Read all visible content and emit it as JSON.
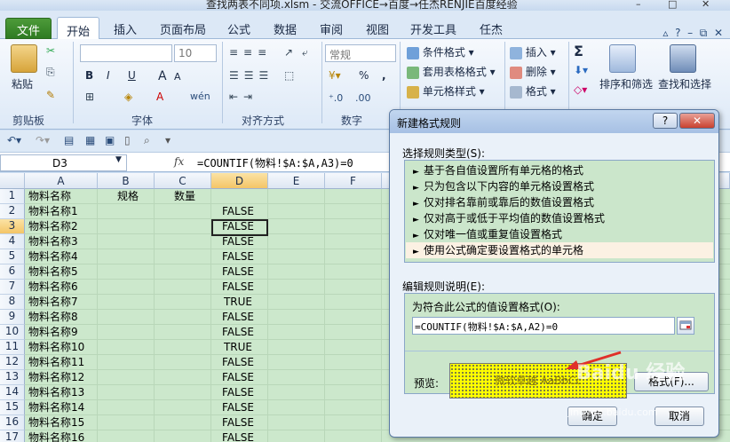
{
  "window": {
    "title": "查找两表不同项.xlsm - 交流OFFICE→百度→任杰RENJIE百度经验",
    "controls": [
      "–",
      "□",
      "✕"
    ]
  },
  "ribbon": {
    "tabs": [
      "文件",
      "开始",
      "插入",
      "页面布局",
      "公式",
      "数据",
      "审阅",
      "视图",
      "开发工具",
      "任杰"
    ],
    "active_tab": "开始",
    "clipboard": {
      "paste": "粘贴",
      "group": "剪贴板"
    },
    "font": {
      "font_size": "10",
      "bold": "B",
      "italic": "I",
      "underline": "U",
      "grow": "A",
      "shrink": "A",
      "wen": "wén",
      "group": "字体"
    },
    "align": {
      "group": "对齐方式"
    },
    "number": {
      "format": "常规",
      "percent": "%",
      "comma": ",",
      "group": "数字"
    },
    "styles": {
      "conditional": "条件格式",
      "table": "套用表格格式",
      "cell": "单元格样式"
    },
    "cells": {
      "insert": "插入",
      "delete": "删除",
      "format": "格式"
    },
    "editing": {
      "sigma": "Σ",
      "sort": "排序和筛选",
      "find": "查找和选择"
    }
  },
  "formula_bar": {
    "name_box": "D3",
    "fx": "fx",
    "formula": "=COUNTIF(物料!$A:$A,A3)=0"
  },
  "sheet": {
    "columns": [
      "A",
      "B",
      "C",
      "D",
      "E",
      "F"
    ],
    "selected_column": "D",
    "selected_row": "3",
    "header_row": {
      "a": "物料名称",
      "b": "规格",
      "c": "数量"
    },
    "rows": [
      {
        "n": "1",
        "a": "物料名称",
        "b": "规格",
        "c": "数量",
        "d": ""
      },
      {
        "n": "2",
        "a": "物料名称1",
        "d": "FALSE"
      },
      {
        "n": "3",
        "a": "物料名称2",
        "d": "FALSE"
      },
      {
        "n": "4",
        "a": "物料名称3",
        "d": "FALSE"
      },
      {
        "n": "5",
        "a": "物料名称4",
        "d": "FALSE"
      },
      {
        "n": "6",
        "a": "物料名称5",
        "d": "FALSE"
      },
      {
        "n": "7",
        "a": "物料名称6",
        "d": "FALSE"
      },
      {
        "n": "8",
        "a": "物料名称7",
        "d": "TRUE"
      },
      {
        "n": "9",
        "a": "物料名称8",
        "d": "FALSE"
      },
      {
        "n": "10",
        "a": "物料名称9",
        "d": "FALSE"
      },
      {
        "n": "11",
        "a": "物料名称10",
        "d": "TRUE"
      },
      {
        "n": "12",
        "a": "物料名称11",
        "d": "FALSE"
      },
      {
        "n": "13",
        "a": "物料名称12",
        "d": "FALSE"
      },
      {
        "n": "14",
        "a": "物料名称13",
        "d": "FALSE"
      },
      {
        "n": "15",
        "a": "物料名称14",
        "d": "FALSE"
      },
      {
        "n": "16",
        "a": "物料名称15",
        "d": "FALSE"
      },
      {
        "n": "17",
        "a": "物料名称16",
        "d": "FALSE"
      }
    ]
  },
  "dialog": {
    "title": "新建格式规则",
    "help": "?",
    "close": "✕",
    "select_type_label": "选择规则类型(S):",
    "rules": [
      "基于各自值设置所有单元格的格式",
      "只为包含以下内容的单元格设置格式",
      "仅对排名靠前或靠后的数值设置格式",
      "仅对高于或低于平均值的数值设置格式",
      "仅对唯一值或重复值设置格式",
      "使用公式确定要设置格式的单元格"
    ],
    "selected_rule_index": 5,
    "edit_desc_label": "编辑规则说明(E):",
    "formula_label": "为符合此公式的值设置格式(O):",
    "formula_value": "=COUNTIF(物料!$A:$A,A2)=0",
    "preview_label": "预览:",
    "preview_text": "微软卓越 AaBbCc",
    "format_button": "格式(F)...",
    "ok_button": "确定",
    "cancel_button": "取消",
    "preview_fill": "#ffff00"
  },
  "watermark": {
    "logo": "Baidu 经验",
    "url": "jingyan.baidu.com"
  },
  "colors": {
    "sheet_bg": "#cce8cc",
    "accent": "#2f7b22",
    "arrow": "#e0302a"
  }
}
